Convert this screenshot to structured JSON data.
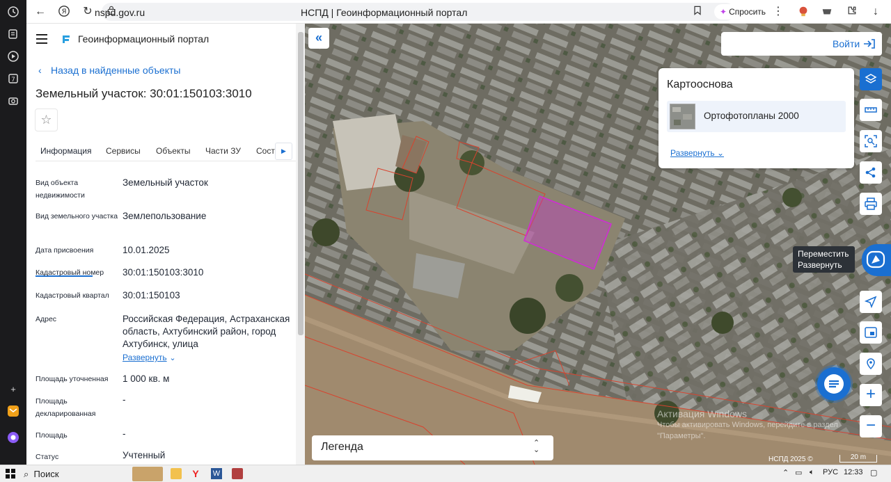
{
  "browser": {
    "url": "nspd.gov.ru",
    "page_title": "НСПД | Геоинформационный портал",
    "ask_label": "Спросить"
  },
  "app": {
    "title": "Геоинформационный портал"
  },
  "panel": {
    "back_label": "Назад в найденные объекты",
    "heading": "Земельный участок: 30:01:150103:3010",
    "tabs": [
      "Информация",
      "Сервисы",
      "Объекты",
      "Части ЗУ",
      "Соста"
    ],
    "fields": [
      {
        "label": "Вид объекта недвижимости",
        "value": "Земельный участок"
      },
      {
        "label": "Вид земельного участка",
        "value": "Землепользование"
      },
      {
        "label": "Дата присвоения",
        "value": "10.01.2025"
      },
      {
        "label": "Кадастровый номер",
        "value": "30:01:150103:3010"
      },
      {
        "label": "Кадастровый квартал",
        "value": "30:01:150103"
      },
      {
        "label": "Адрес",
        "value": "Российская Федерация, Астраханская область, Ахтубинский район, город Ахтубинск, улица",
        "expand": "Развернуть"
      },
      {
        "label": "Площадь уточненная",
        "value": "1 000 кв. м"
      },
      {
        "label": "Площадь декларированная",
        "value": "-"
      },
      {
        "label": "Площадь",
        "value": "-"
      },
      {
        "label": "Статус",
        "value": "Учтенный"
      }
    ]
  },
  "map": {
    "login_label": "Войти",
    "basemap": {
      "title": "Картооснова",
      "option": "Ортофотопланы 2000",
      "expand": "Развернуть"
    },
    "tooltip": {
      "line1": "Переместить",
      "line2": "Развернуть"
    },
    "legend_label": "Легенда",
    "copyright": "НСПД 2025 ©",
    "scale_label": "20 m",
    "zoom_in": "+",
    "zoom_out": "−",
    "watermark": {
      "line1": "Активация Windows",
      "line2": "Чтобы активировать Windows, перейдите в раздел",
      "line3": "\"Параметры\"."
    }
  },
  "taskbar": {
    "search_label": "Поиск",
    "lang": "РУС",
    "time": "12:33"
  },
  "colors": {
    "accent": "#1a6fd1",
    "parcel_highlight": "#d12bd6",
    "parcel_border": "#d8432e"
  }
}
